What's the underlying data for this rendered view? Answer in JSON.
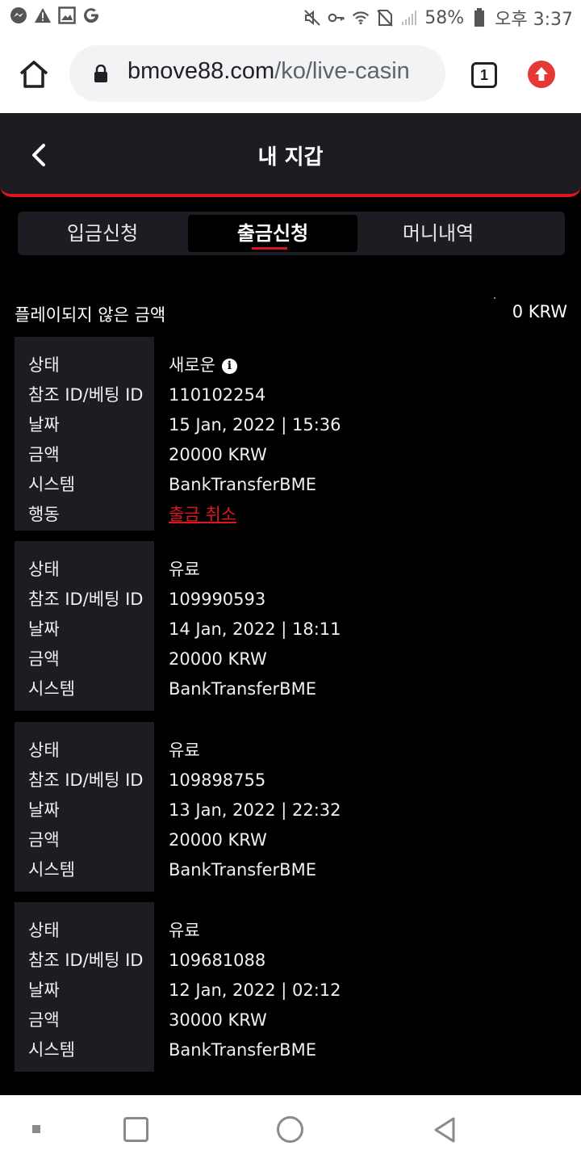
{
  "status_bar": {
    "battery": "58%",
    "time": "오후 3:37",
    "left_icons": [
      "messenger-icon",
      "warning-icon",
      "image-icon",
      "google-icon"
    ],
    "right_icons": [
      "mute-icon",
      "key-icon",
      "wifi-icon",
      "no-sim-icon",
      "signal-icon",
      "battery-icon"
    ]
  },
  "browser": {
    "url_domain": "bmove88.com",
    "url_path": "/ko/live-casin",
    "tab_count": "1"
  },
  "header": {
    "title": "내 지갑"
  },
  "tabs": [
    {
      "label": "입금신청",
      "active": false
    },
    {
      "label": "출금신청",
      "active": true
    },
    {
      "label": "머니내역",
      "active": false
    }
  ],
  "summary": {
    "label": "플레이되지 않은 금액",
    "value": "0 KRW"
  },
  "labels": {
    "status": "상태",
    "reference": "참조 ID/베팅 ID",
    "date": "날짜",
    "amount": "금액",
    "system": "시스템",
    "action": "행동"
  },
  "transactions": [
    {
      "status": "새로운",
      "reference": "110102254",
      "date": "15 Jan, 2022 | 15:36",
      "amount": "20000 KRW",
      "system": "BankTransferBME",
      "action": "출금 취소"
    },
    {
      "status": "유료",
      "reference": "109990593",
      "date": "14 Jan, 2022 | 18:11",
      "amount": "20000 KRW",
      "system": "BankTransferBME"
    },
    {
      "status": "유료",
      "reference": "109898755",
      "date": "13 Jan, 2022 | 22:32",
      "amount": "20000 KRW",
      "system": "BankTransferBME"
    },
    {
      "status": "유료",
      "reference": "109681088",
      "date": "12 Jan, 2022 | 02:12",
      "amount": "30000 KRW",
      "system": "BankTransferBME"
    }
  ],
  "colors": {
    "accent": "#e0161e",
    "panel": "#1c1d22",
    "background": "#000000"
  }
}
